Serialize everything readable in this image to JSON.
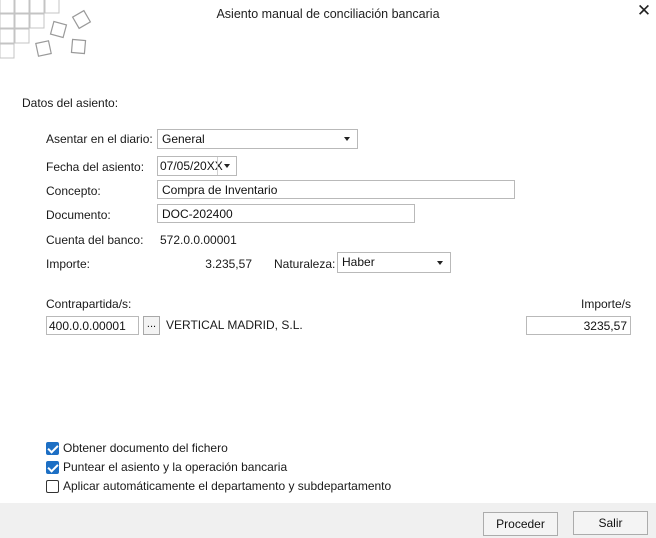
{
  "window": {
    "title": "Asiento manual de conciliación bancaria",
    "close_glyph": "✕"
  },
  "form": {
    "section_title": "Datos del asiento:",
    "diario": {
      "label": "Asentar en el diario:",
      "value": "General"
    },
    "fecha": {
      "label": "Fecha del asiento:",
      "value": "07/05/20XX"
    },
    "concepto": {
      "label": "Concepto:",
      "value": "Compra de Inventario"
    },
    "documento": {
      "label": "Documento:",
      "value": "DOC-202400"
    },
    "cuenta": {
      "label": "Cuenta del banco:",
      "value": "572.0.0.00001"
    },
    "importe": {
      "label": "Importe:",
      "value": "3.235,57"
    },
    "naturaleza": {
      "label": "Naturaleza:",
      "value": "Haber"
    }
  },
  "contrapartidas": {
    "header_left": "Contrapartida/s:",
    "header_right": "Importe/s",
    "rows": [
      {
        "account": "400.0.0.00001",
        "lookup_label": "...",
        "name": "VERTICAL MADRID, S.L.",
        "amount": "3235,57"
      }
    ]
  },
  "options": [
    {
      "label": "Obtener documento del fichero",
      "checked": true
    },
    {
      "label": "Puntear el asiento y la operación bancaria",
      "checked": true
    },
    {
      "label": "Aplicar automáticamente el departamento y subdepartamento",
      "checked": false
    }
  ],
  "footer": {
    "proceed_label": "Proceder",
    "exit_label": "Salir"
  },
  "colors": {
    "accent": "#1d6fc4",
    "footer_bg": "#f0f0f0",
    "logo_square": "#bdbdbd"
  }
}
